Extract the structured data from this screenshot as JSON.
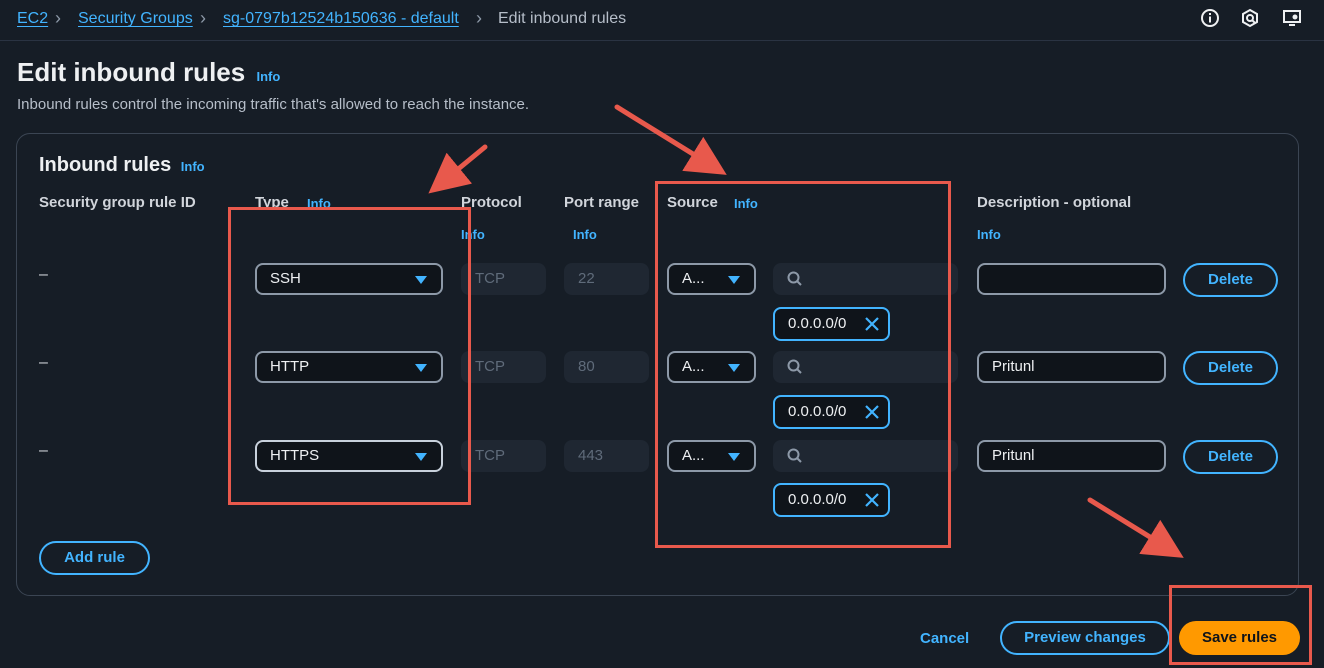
{
  "breadcrumb": {
    "items": [
      "EC2",
      "Security Groups",
      "sg-0797b12524b150636 - default"
    ],
    "current": "Edit inbound rules"
  },
  "page": {
    "title": "Edit inbound rules",
    "info": "Info",
    "subtitle": "Inbound rules control the incoming traffic that's allowed to reach the instance."
  },
  "panel": {
    "title": "Inbound rules",
    "info": "Info",
    "columns": {
      "rule_id": "Security group rule ID",
      "type": "Type",
      "protocol": "Protocol",
      "port_range": "Port range",
      "source": "Source",
      "description": "Description - optional",
      "info": "Info"
    },
    "rows": [
      {
        "rule_id": "–",
        "type": "SSH",
        "protocol": "TCP",
        "port": "22",
        "source_type": "A...",
        "cidr": "0.0.0.0/0",
        "description": "",
        "delete": "Delete"
      },
      {
        "rule_id": "–",
        "type": "HTTP",
        "protocol": "TCP",
        "port": "80",
        "source_type": "A...",
        "cidr": "0.0.0.0/0",
        "description": "Pritunl",
        "delete": "Delete"
      },
      {
        "rule_id": "–",
        "type": "HTTPS",
        "protocol": "TCP",
        "port": "443",
        "source_type": "A...",
        "cidr": "0.0.0.0/0",
        "description": "Pritunl",
        "delete": "Delete"
      }
    ],
    "add_rule": "Add rule"
  },
  "footer": {
    "cancel": "Cancel",
    "preview": "Preview changes",
    "save": "Save rules"
  },
  "icons": [
    "info-circle-icon",
    "feedback-icon",
    "display-settings-icon",
    "search-icon",
    "close-icon",
    "caret-down-icon"
  ],
  "colors": {
    "accent": "#42b4ff",
    "primary": "#ff9900",
    "annotation": "#e8594c",
    "background": "#161d26"
  }
}
